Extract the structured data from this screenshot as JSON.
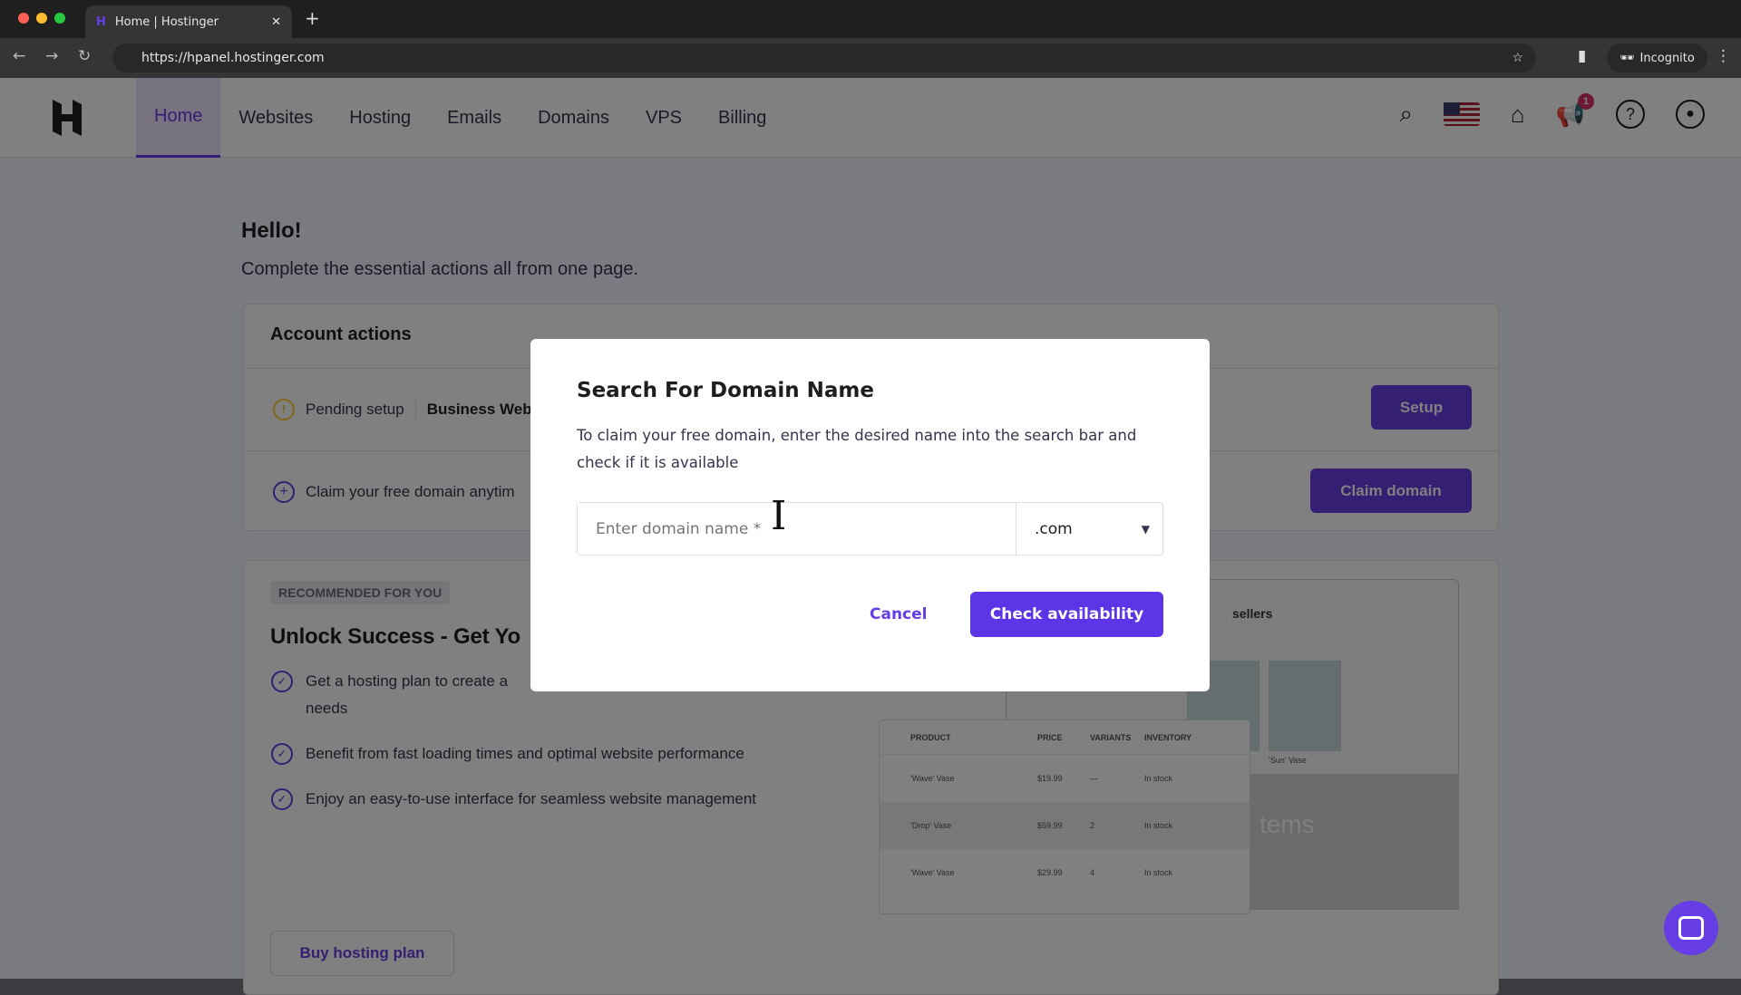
{
  "browser": {
    "tab_title": "Home | Hostinger",
    "url": "https://hpanel.hostinger.com",
    "incognito_label": "Incognito"
  },
  "header": {
    "nav": [
      {
        "label": "Home",
        "active": true
      },
      {
        "label": "Websites"
      },
      {
        "label": "Hosting"
      },
      {
        "label": "Emails"
      },
      {
        "label": "Domains"
      },
      {
        "label": "VPS"
      },
      {
        "label": "Billing"
      }
    ],
    "notification_count": "1"
  },
  "main": {
    "greeting": "Hello!",
    "subtitle": "Complete the essential actions all from one page.",
    "account_actions": {
      "title": "Account actions",
      "pending_label": "Pending setup",
      "pending_item": "Business Web",
      "setup_button": "Setup",
      "claim_text": "Claim your free domain anytim",
      "claim_button": "Claim domain"
    },
    "recommended": {
      "badge": "RECOMMENDED FOR YOU",
      "title": "Unlock Success - Get Yo",
      "items": [
        "Get a hosting plan to create a",
        "needs",
        "Benefit from fast loading times and optimal website performance",
        "Enjoy an easy-to-use interface for seamless website management"
      ],
      "button": "Buy hosting plan"
    },
    "mock": {
      "sellers": "sellers",
      "headers": [
        "PRODUCT",
        "PRICE",
        "VARIANTS",
        "INVENTORY"
      ],
      "rows": [
        [
          "'Wave' Vase",
          "$19.99",
          "—",
          "In stock"
        ],
        [
          "'Drop' Vase",
          "$59.99",
          "2",
          "In stock"
        ],
        [
          "'Wave' Vase",
          "$29.99",
          "4",
          "In stock"
        ]
      ],
      "items_text": "tems",
      "card_label": "'Sun' Vase"
    }
  },
  "modal": {
    "title": "Search For Domain Name",
    "description": "To claim your free domain, enter the desired name into the search bar and check if it is available",
    "input_placeholder": "Enter domain name *",
    "tld": ".com",
    "cancel": "Cancel",
    "check": "Check availability"
  },
  "colors": {
    "accent": "#673de6",
    "badge": "#d63163"
  }
}
